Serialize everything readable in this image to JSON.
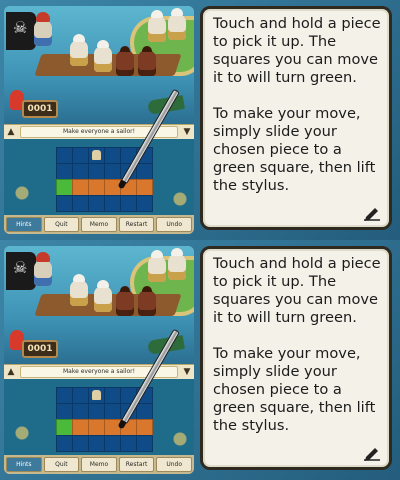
{
  "panels": [
    {
      "game": {
        "sign_number": "0001",
        "objective": "Make everyone a sailor!",
        "buttons": [
          "Hints",
          "Quit",
          "Memo",
          "Restart",
          "Undo"
        ]
      },
      "dialog": {
        "paragraph1": "Touch and hold a piece to pick it up. The squares you can move it to will turn green.",
        "paragraph2": "To make your move, simply slide your chosen piece to a green square, then lift the stylus."
      }
    },
    {
      "game": {
        "sign_number": "0001",
        "objective": "Make everyone a sailor!",
        "buttons": [
          "Hints",
          "Quit",
          "Memo",
          "Restart",
          "Undo"
        ]
      },
      "dialog": {
        "paragraph1": "Touch and hold a piece to pick it up. The squares you can move it to will turn green.",
        "paragraph2": "To make your move, simply slide your chosen piece to a green square, then lift the stylus."
      }
    }
  ],
  "icons": {
    "dialog_continue": "pencil-icon",
    "scroll_left": "up-arrow-icon",
    "scroll_right": "down-arrow-icon"
  }
}
